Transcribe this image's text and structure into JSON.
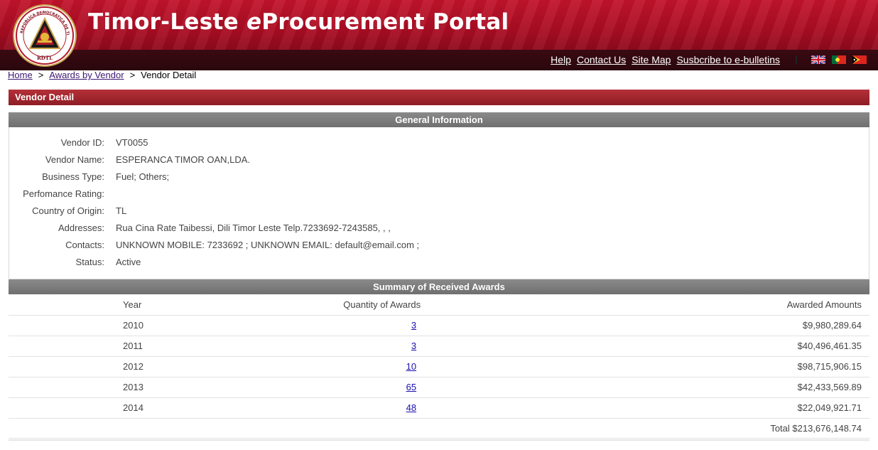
{
  "header": {
    "title_pre": "Timor-Leste ",
    "title_e": "e",
    "title_post": "Procurement Portal",
    "logo_text_top": "REPÚBLICA DEMOCRÁTICA DE TIMOR-LESTE",
    "logo_text_bottom": "RDTL",
    "links": [
      {
        "label": "Help"
      },
      {
        "label": "Contact Us"
      },
      {
        "label": "Site Map"
      },
      {
        "label": "Susbcribe to e-bulletins"
      }
    ],
    "flags": [
      "uk-flag",
      "portugal-flag",
      "timor-leste-flag"
    ],
    "colors": {
      "brand_red": "#a80c22",
      "dark_bar": "#2a070d"
    }
  },
  "breadcrumb": {
    "home": "Home",
    "awards": "Awards by Vendor",
    "current": "Vendor Detail",
    "separator": ">"
  },
  "vendor_bar_title": "Vendor Detail",
  "general": {
    "title": "General Information",
    "rows": [
      {
        "label": "Vendor ID:",
        "value": "VT0055"
      },
      {
        "label": "Vendor Name:",
        "value": "ESPERANCA TIMOR OAN,LDA."
      },
      {
        "label": "Business Type:",
        "value": "Fuel;  Others;"
      },
      {
        "label": "Perfomance Rating:",
        "value": ""
      },
      {
        "label": "Country of Origin:",
        "value": "TL"
      },
      {
        "label": "Addresses:",
        "value": "Rua Cina Rate Taibessi, Dili Timor Leste Telp.7233692-7243585, , ,"
      },
      {
        "label": "Contacts:",
        "value": "UNKNOWN MOBILE: 7233692 ;  UNKNOWN EMAIL: default@email.com ;"
      },
      {
        "label": "Status:",
        "value": "Active"
      }
    ]
  },
  "summary": {
    "title": "Summary of Received Awards",
    "headers": {
      "year": "Year",
      "qty": "Quantity of Awards",
      "amount": "Awarded Amounts"
    },
    "rows": [
      {
        "year": "2010",
        "qty": "3",
        "amount": "$9,980,289.64"
      },
      {
        "year": "2011",
        "qty": "3",
        "amount": "$40,496,461.35"
      },
      {
        "year": "2012",
        "qty": "10",
        "amount": "$98,715,906.15"
      },
      {
        "year": "2013",
        "qty": "65",
        "amount": "$42,433,569.89"
      },
      {
        "year": "2014",
        "qty": "48",
        "amount": "$22,049,921.71"
      }
    ],
    "total": "Total $213,676,148.74"
  }
}
